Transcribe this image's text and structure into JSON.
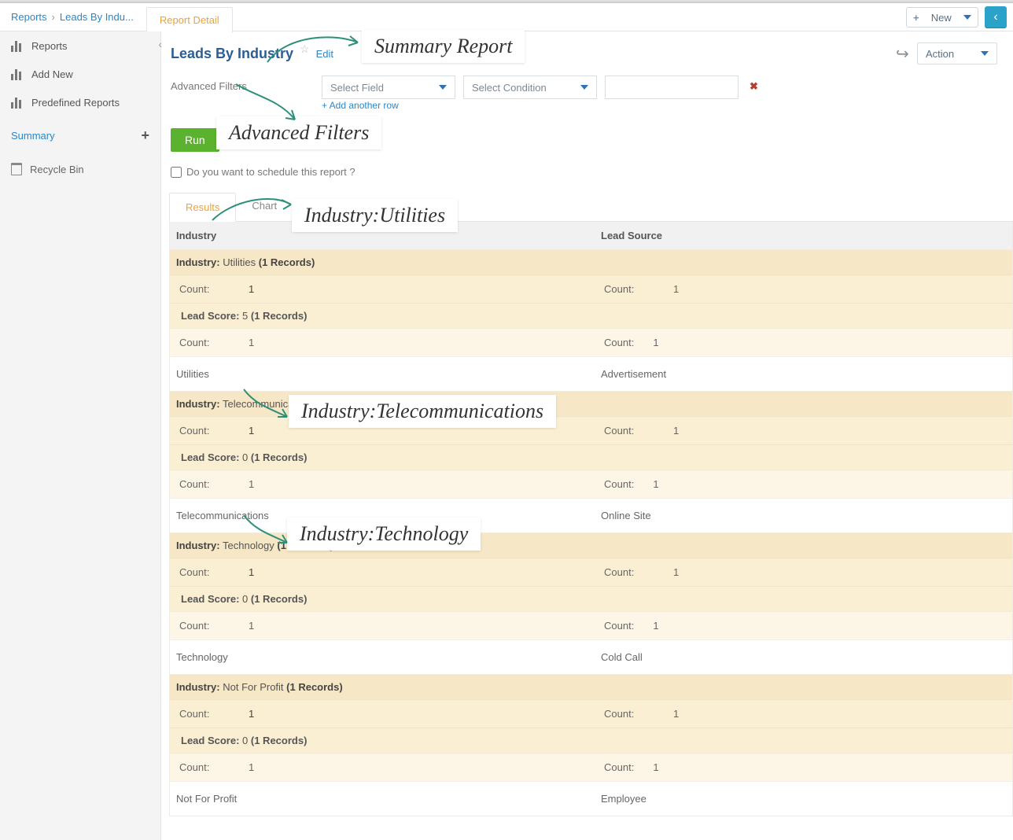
{
  "breadcrumb": {
    "root": "Reports",
    "current": "Leads By Indu..."
  },
  "tab_detail": "Report Detail",
  "new_btn": "New",
  "sidebar": {
    "items": [
      "Reports",
      "Add New",
      "Predefined Reports"
    ],
    "summary": "Summary",
    "recycle": "Recycle Bin"
  },
  "title": "Leads By Industry",
  "edit": "Edit",
  "action_label": "Action",
  "filters": {
    "label": "Advanced Filters",
    "field_ph": "Select Field",
    "cond_ph": "Select Condition",
    "add_row": "+ Add another row"
  },
  "run": "Run",
  "schedule_q": "Do you want to schedule this report ?",
  "rtabs": {
    "results": "Results",
    "chart": "Chart"
  },
  "cols": {
    "c1": "Industry",
    "c2": "Lead Source"
  },
  "count_lbl": "Count:",
  "industry_lbl": "Industry:",
  "leadscore_lbl": "Lead Score:",
  "records_sfx_1": "(1 Records)",
  "groups": [
    {
      "industry": "Utilities",
      "rec": "1",
      "count1": "1",
      "count2": "1",
      "score": "5",
      "srec": "1",
      "scount1": "1",
      "scount2": "1",
      "row_industry": "Utilities",
      "row_source": "Advertisement"
    },
    {
      "industry": "Telecommunications",
      "rec": "1",
      "count1": "1",
      "count2": "1",
      "score": "0",
      "srec": "1",
      "scount1": "1",
      "scount2": "1",
      "row_industry": "Telecommunications",
      "row_source": "Online Site"
    },
    {
      "industry": "Technology",
      "rec": "1",
      "count1": "1",
      "count2": "1",
      "score": "0",
      "srec": "1",
      "scount1": "1",
      "scount2": "1",
      "row_industry": "Technology",
      "row_source": "Cold Call"
    },
    {
      "industry": "Not For Profit",
      "rec": "1",
      "count1": "1",
      "count2": "1",
      "score": "0",
      "srec": "1",
      "scount1": "1",
      "scount2": "1",
      "row_industry": "Not For Profit",
      "row_source": "Employee"
    }
  ],
  "annotations": {
    "summary": "Summary Report",
    "filters": "Advanced Filters",
    "g0": "Industry:Utilities",
    "g1": "Industry:Telecommunications",
    "g2": "Industry:Technology"
  }
}
